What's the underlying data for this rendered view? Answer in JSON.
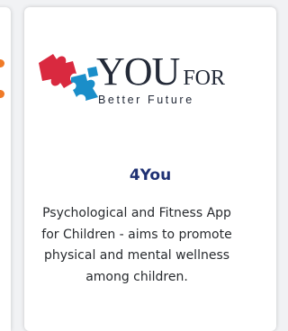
{
  "project": {
    "logo": {
      "icon": "puzzle-pieces-icon",
      "main_word": "YOU",
      "secondary_word": "FOR",
      "tagline": "Better Future",
      "colors": {
        "puzzle_red": "#d9293f",
        "puzzle_blue": "#1a8ec9",
        "text": "#232a38"
      }
    },
    "title": "4You",
    "description": "Psychological and Fitness App for Children - aims to promote physical and mental wellness among children."
  },
  "theme": {
    "title_color": "#1f3173",
    "accent_orange": "#f07a27"
  }
}
